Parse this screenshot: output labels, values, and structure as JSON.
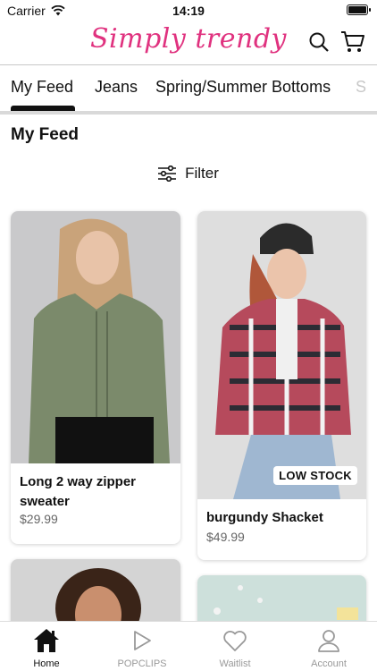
{
  "status_bar": {
    "carrier": "Carrier",
    "time": "14:19"
  },
  "header": {
    "logo": "Simply trendy",
    "icons": [
      "search-icon",
      "cart-icon"
    ]
  },
  "tabs": [
    {
      "label": "My Feed",
      "active": true
    },
    {
      "label": "Jeans",
      "active": false
    },
    {
      "label": "Spring/Summer Bottoms",
      "active": false
    },
    {
      "label": "S",
      "active": false
    }
  ],
  "feed": {
    "title": "My Feed",
    "filter_label": "Filter",
    "products": [
      {
        "name": "Long 2 way zipper sweater",
        "price": "$29.99",
        "badge": ""
      },
      {
        "name": "burgundy Shacket",
        "price": "$49.99",
        "badge": "LOW STOCK"
      }
    ]
  },
  "bottom_nav": [
    {
      "label": "Home",
      "icon": "home-icon",
      "active": true
    },
    {
      "label": "POPCLIPS",
      "icon": "play-icon",
      "active": false
    },
    {
      "label": "Waitlist",
      "icon": "heart-icon",
      "active": false
    },
    {
      "label": "Account",
      "icon": "account-icon",
      "active": false
    }
  ],
  "colors": {
    "brand": "#e0327f",
    "active": "#111111",
    "inactive": "#999999"
  }
}
